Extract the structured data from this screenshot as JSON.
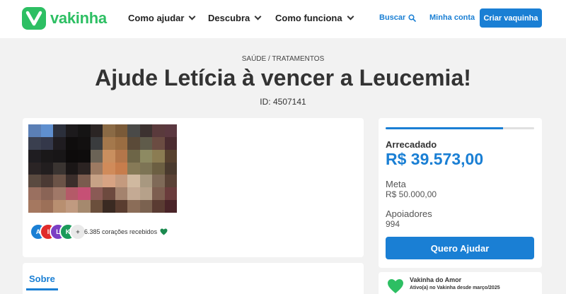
{
  "header": {
    "brand": "vakinha",
    "nav": [
      {
        "label": "Como ajudar"
      },
      {
        "label": "Descubra"
      },
      {
        "label": "Como funciona"
      }
    ],
    "search_label": "Buscar",
    "account_label": "Minha conta",
    "create_label": "Criar vaquinha"
  },
  "campaign": {
    "category": "SAÚDE / TRATAMENTOS",
    "title": "Ajude Letícia à vencer a Leucemia!",
    "id_text": "ID: 4507141",
    "hearts_text": "6.385 corações recebidos",
    "supporter_avatars": [
      {
        "initial": "A",
        "color": "#1a7fd4"
      },
      {
        "initial": "I",
        "color": "#e02b2b"
      },
      {
        "initial": "L",
        "color": "#7b3fc4"
      },
      {
        "initial": "K",
        "color": "#1b9a5a"
      },
      {
        "initial": "+",
        "color": "#e9e9e9"
      }
    ],
    "tabs": [
      {
        "label": "Sobre"
      }
    ]
  },
  "stats": {
    "progress_fraction": 0.79,
    "raised_label": "Arrecadado",
    "raised_value": "R$ 39.573,00",
    "goal_label": "Meta",
    "goal_value": "R$ 50.000,00",
    "supporters_label": "Apoiadores",
    "supporters_value": "994",
    "cta_label": "Quero Ajudar"
  },
  "organizer": {
    "name": "Vakinha do Amor",
    "since": "Ativo(a) no Vakinha desde março/2025"
  },
  "colors": {
    "brand_green": "#2dbf63",
    "accent_blue": "#1a7fd4"
  },
  "photo_pixels": [
    "#5b7fb5",
    "#5f8fcf",
    "#2b2f3b",
    "#1c1a1c",
    "#151414",
    "#2b2524",
    "#8a6a45",
    "#7a5a38",
    "#4a4a48",
    "#3c3230",
    "#5a3a3c",
    "#5b3840",
    "#3a3f4f",
    "#34384a",
    "#1f1c20",
    "#0f0d0d",
    "#121010",
    "#3a3c3e",
    "#a4784c",
    "#9a6d42",
    "#5a4a38",
    "#5f5b4a",
    "#6b4c42",
    "#4b2c30",
    "#1f1d21",
    "#1a1819",
    "#181617",
    "#0d0b0b",
    "#0e0c0c",
    "#6b6356",
    "#c98f5f",
    "#b3764a",
    "#6d6547",
    "#8d8a62",
    "#8b7c52",
    "#57412f",
    "#2a2425",
    "#221e1f",
    "#3a3431",
    "#1a1616",
    "#2b2322",
    "#9c7a62",
    "#d08b5a",
    "#c77d4c",
    "#867a57",
    "#7d7455",
    "#6c5f42",
    "#4a3a2e",
    "#5a4a40",
    "#4b3a34",
    "#6b5347",
    "#3b2e2b",
    "#7a5b4e",
    "#c7a286",
    "#d7a383",
    "#c49a7e",
    "#d0b9a0",
    "#a89880",
    "#7f6a58",
    "#5a4236",
    "#9a7060",
    "#8a6456",
    "#a07868",
    "#b45a68",
    "#c65075",
    "#8a5a55",
    "#6d4a3f",
    "#a4836e",
    "#c4aa94",
    "#b6a18a",
    "#7d5e50",
    "#6a3c3c",
    "#a57860",
    "#9c7058",
    "#b88f70",
    "#c09a80",
    "#a5896e",
    "#6b4f3c",
    "#3a2a22",
    "#5a3d30",
    "#8b6d58",
    "#7b6250",
    "#5a3b32",
    "#4a2428"
  ]
}
